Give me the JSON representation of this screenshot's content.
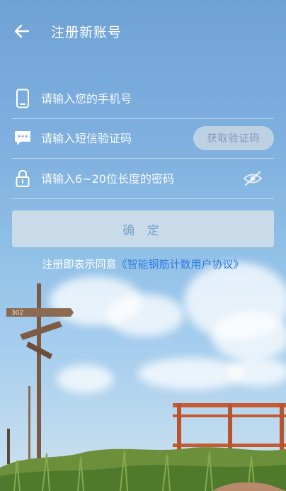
{
  "header": {
    "title": "注册新账号"
  },
  "form": {
    "phone_placeholder": "请输入您的手机号",
    "code_placeholder": "请输入短信验证码",
    "get_code_label": "获取验证码",
    "password_placeholder": "请输入6~20位长度的密码"
  },
  "confirm_label": "确 定",
  "agreement": {
    "prefix": "注册即表示同意",
    "link": "《智能钢筋计数用户协议》"
  },
  "background": {
    "sign_text": "302"
  },
  "colors": {
    "link": "#2f7de0",
    "button_bg": "#d2dee8",
    "button_text": "#7aa3cc"
  },
  "icons": [
    "back-arrow-icon",
    "phone-icon",
    "message-icon",
    "lock-icon",
    "eye-off-icon"
  ]
}
